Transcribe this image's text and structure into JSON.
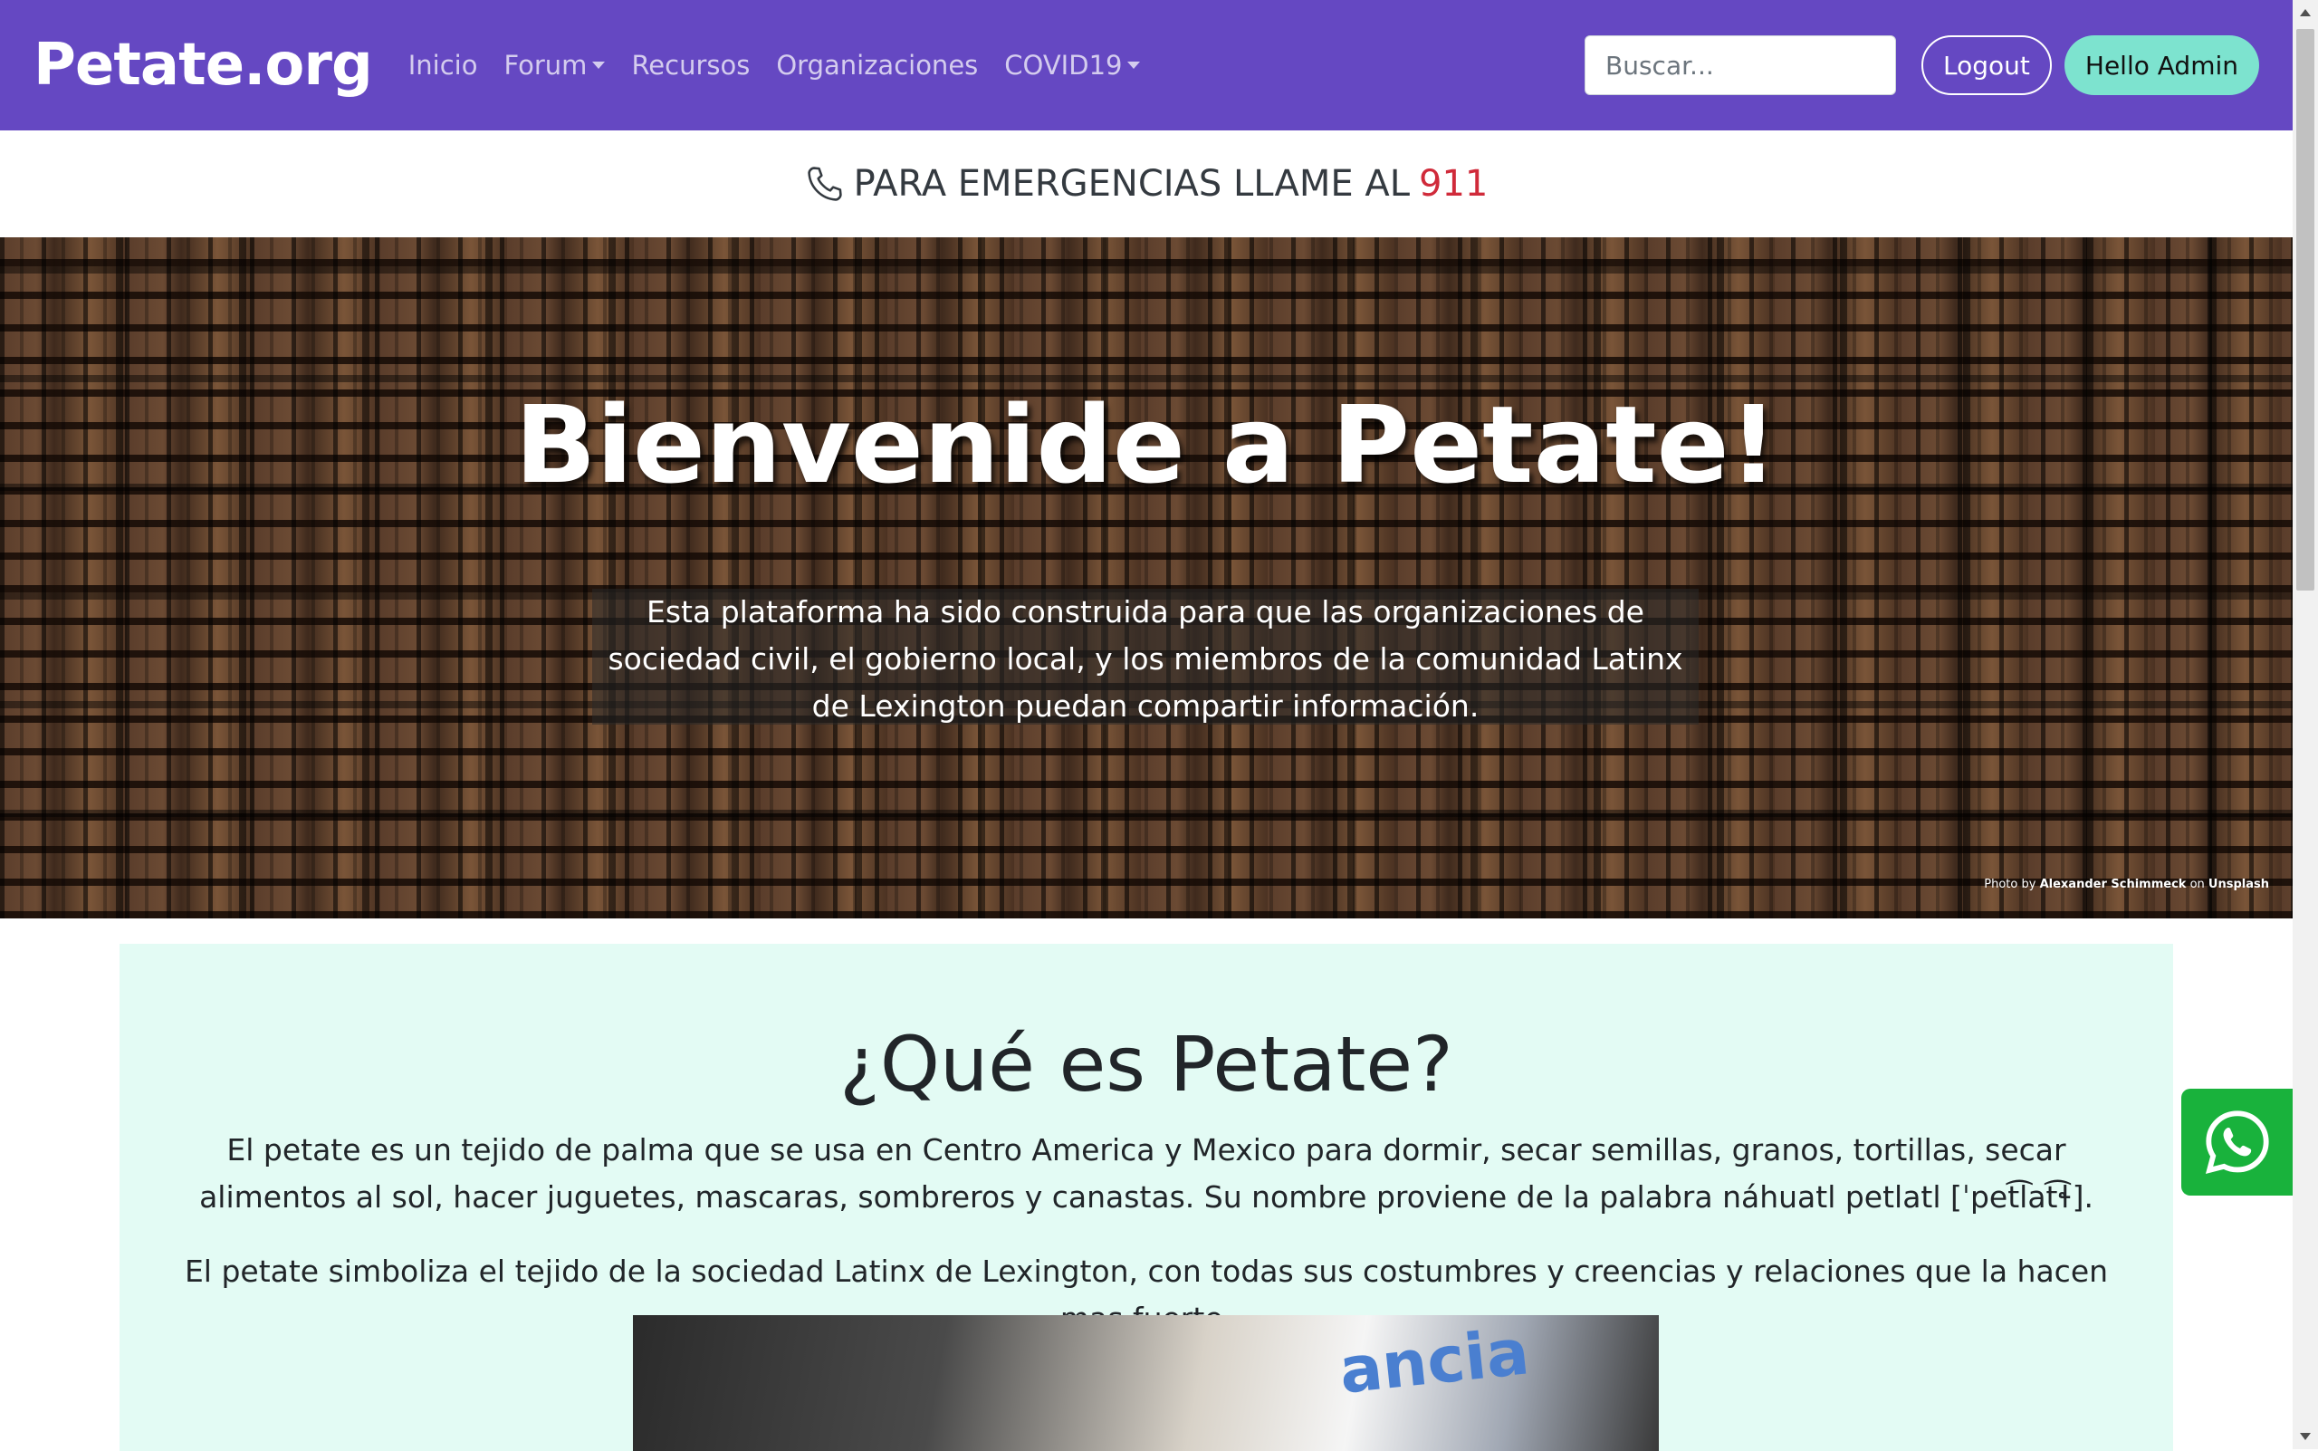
{
  "navbar": {
    "brand": "Petate.org",
    "links": {
      "inicio": "Inicio",
      "forum": "Forum",
      "recursos": "Recursos",
      "organizaciones": "Organizaciones",
      "covid": "COVID19"
    },
    "search_placeholder": "Buscar...",
    "logout": "Logout",
    "hello": "Hello Admin"
  },
  "emergency": {
    "text": "PARA EMERGENCIAS LLAME AL",
    "number": "911"
  },
  "hero": {
    "title": "Bienvenide a Petate!",
    "description": "Esta plataforma ha sido construida para que las organizaciones de sociedad civil, el gobierno local, y los miembros de la comunidad Latinx de Lexington puedan compartir información.",
    "credit_prefix": "Photo by",
    "credit_author": "Alexander Schimmeck",
    "credit_mid": "on",
    "credit_site": "Unsplash"
  },
  "about": {
    "title": "¿Qué es Petate?",
    "p1": "El petate es un tejido de palma que se usa en Centro America y Mexico para dormir, secar semillas, granos, tortillas, secar alimentos al sol, hacer juguetes, mascaras, sombreros y canastas. Su nombre proviene de la palabra náhuatl petlatl [ˈpet͡lat͡ɬ].",
    "p2": "El petate simboliza el tejido de la sociedad Latinx de Lexington, con todas sus costumbres y creencias y relaciones que la hacen mas fuerte.",
    "photo_text": "ancia"
  },
  "colors": {
    "navbar_bg": "#6548c2",
    "hello_btn_bg": "#7de3cf",
    "emergency_number": "#d02a3a",
    "about_bg": "#e3fbf4",
    "whatsapp_bg": "#19b23c"
  },
  "icons": {
    "phone": "phone-icon",
    "whatsapp": "whatsapp-icon"
  }
}
